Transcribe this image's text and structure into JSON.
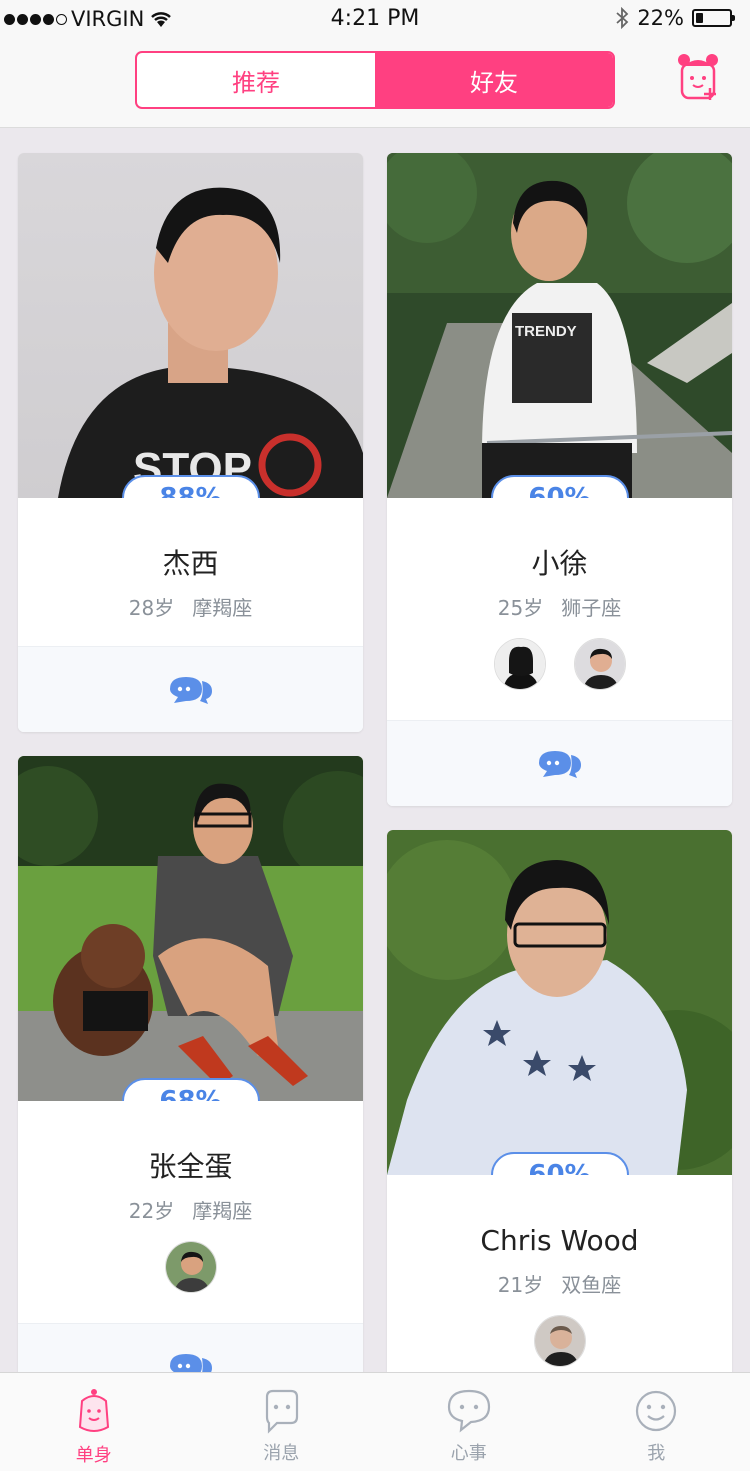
{
  "status_bar": {
    "carrier": "VIRGIN",
    "time": "4:21 PM",
    "battery": "22%",
    "battery_level": 0.22
  },
  "header": {
    "tabs": [
      {
        "label": "推荐",
        "active": false
      },
      {
        "label": "好友",
        "active": true
      }
    ],
    "add_icon": "add-friend-icon"
  },
  "colors": {
    "accent": "#ff4081",
    "match_blue": "#4a84e6",
    "muted_text": "#8a9199"
  },
  "cards": [
    {
      "match": "88%",
      "name": "杰西",
      "age": "28岁",
      "sign": "摩羯座",
      "friends": []
    },
    {
      "match": "60%",
      "name": "小徐",
      "age": "25岁",
      "sign": "狮子座",
      "friends": [
        "friend-avatar-1",
        "friend-avatar-2"
      ]
    },
    {
      "match": "68%",
      "name": "张全蛋",
      "age": "22岁",
      "sign": "摩羯座",
      "friends": [
        "friend-avatar-3"
      ]
    },
    {
      "match": "60%",
      "name": "Chris Wood",
      "age": "21岁",
      "sign": "双鱼座",
      "friends": [
        "friend-avatar-4"
      ]
    }
  ],
  "tabbar": {
    "items": [
      {
        "label": "单身",
        "icon": "single-icon",
        "active": true
      },
      {
        "label": "消息",
        "icon": "message-icon",
        "active": false
      },
      {
        "label": "心事",
        "icon": "heart-talk-icon",
        "active": false
      },
      {
        "label": "我",
        "icon": "me-icon",
        "active": false
      }
    ]
  }
}
